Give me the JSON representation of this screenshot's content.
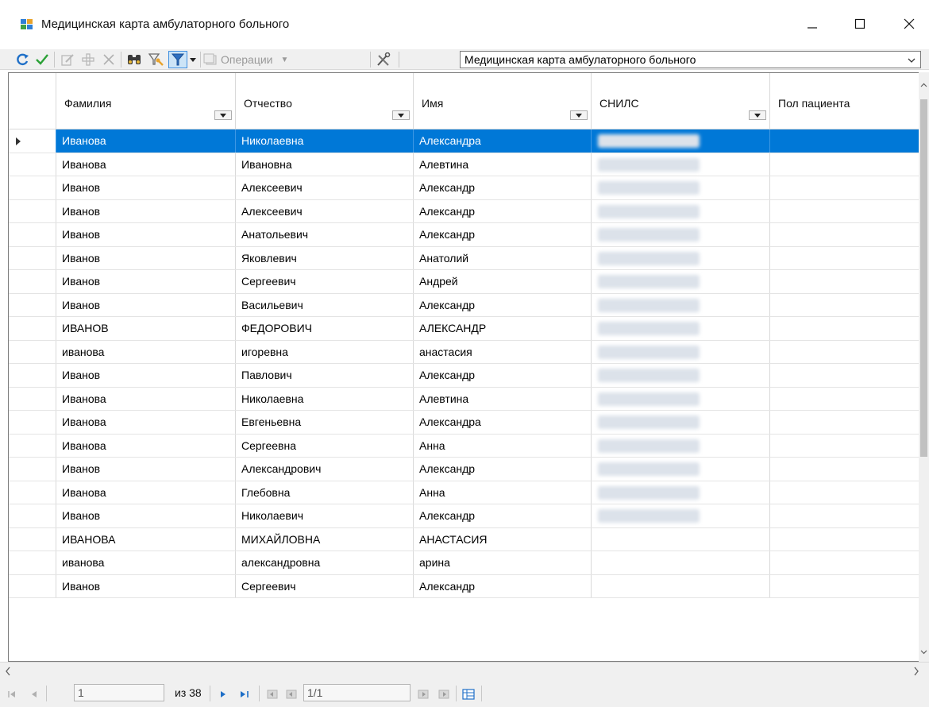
{
  "window": {
    "title": "Медицинская карта амбулаторного больного",
    "controls": {
      "minimize": "—",
      "maximize": "☐",
      "close": "✕"
    }
  },
  "toolbar": {
    "operations_label": "Операции",
    "view_selector_value": "Медицинская карта амбулаторного больного",
    "icons": [
      "refresh-icon",
      "apply-check-icon",
      "edit-icon",
      "add-icon",
      "delete-icon",
      "find-binoculars-icon",
      "filter-settings-icon",
      "filter-icon",
      "operations-icon",
      "tools-icon"
    ]
  },
  "grid": {
    "columns": [
      "Фамилия",
      "Отчество",
      "Имя",
      "СНИЛС",
      "Пол пациента"
    ],
    "rows": [
      {
        "last": "Иванова",
        "middle": "Николаевна",
        "first": "Александра",
        "snils_blurred": true,
        "sex": ""
      },
      {
        "last": "Иванова",
        "middle": "Ивановна",
        "first": "Алевтина",
        "snils_blurred": true,
        "sex": ""
      },
      {
        "last": "Иванов",
        "middle": "Алексеевич",
        "first": "Александр",
        "snils_blurred": true,
        "sex": ""
      },
      {
        "last": "Иванов",
        "middle": "Алексеевич",
        "first": "Александр",
        "snils_blurred": true,
        "sex": ""
      },
      {
        "last": "Иванов",
        "middle": "Анатольевич",
        "first": "Александр",
        "snils_blurred": true,
        "sex": ""
      },
      {
        "last": "Иванов",
        "middle": "Яковлевич",
        "first": "Анатолий",
        "snils_blurred": true,
        "sex": ""
      },
      {
        "last": "Иванов",
        "middle": "Сергеевич",
        "first": "Андрей",
        "snils_blurred": true,
        "sex": ""
      },
      {
        "last": "Иванов",
        "middle": "Васильевич",
        "first": "Александр",
        "snils_blurred": true,
        "sex": ""
      },
      {
        "last": "ИВАНОВ",
        "middle": "ФЕДОРОВИЧ",
        "first": "АЛЕКСАНДР",
        "snils_blurred": true,
        "sex": ""
      },
      {
        "last": "иванова",
        "middle": "игоревна",
        "first": "анастасия",
        "snils_blurred": true,
        "sex": ""
      },
      {
        "last": "Иванов",
        "middle": "Павлович",
        "first": "Александр",
        "snils_blurred": true,
        "sex": ""
      },
      {
        "last": "Иванова",
        "middle": "Николаевна",
        "first": "Алевтина",
        "snils_blurred": true,
        "sex": ""
      },
      {
        "last": "Иванова",
        "middle": "Евгеньевна",
        "first": "Александра",
        "snils_blurred": true,
        "sex": ""
      },
      {
        "last": "Иванова",
        "middle": "Сергеевна",
        "first": "Анна",
        "snils_blurred": true,
        "sex": ""
      },
      {
        "last": "Иванов",
        "middle": "Александрович",
        "first": "Александр",
        "snils_blurred": true,
        "sex": ""
      },
      {
        "last": "Иванова",
        "middle": "Глебовна",
        "first": "Анна",
        "snils_blurred": true,
        "sex": ""
      },
      {
        "last": "Иванов",
        "middle": "Николаевич",
        "first": "Александр",
        "snils_blurred": true,
        "sex": ""
      },
      {
        "last": "ИВАНОВА",
        "middle": "МИХАЙЛОВНА",
        "first": "АНАСТАСИЯ",
        "snils_blurred": false,
        "sex": ""
      },
      {
        "last": "иванова",
        "middle": "александровна",
        "first": "арина",
        "snils_blurred": false,
        "sex": ""
      },
      {
        "last": "Иванов",
        "middle": "Сергеевич",
        "first": "Александр",
        "snils_blurred": false,
        "sex": ""
      }
    ],
    "selected_row": 0
  },
  "pager": {
    "page_input": "1",
    "of_label": "из 38",
    "record_input": "1/1"
  },
  "colors": {
    "selection": "#0078d7",
    "filter_active_bg": "#cce4f7",
    "toolbar_bg": "#f0f0f0"
  }
}
